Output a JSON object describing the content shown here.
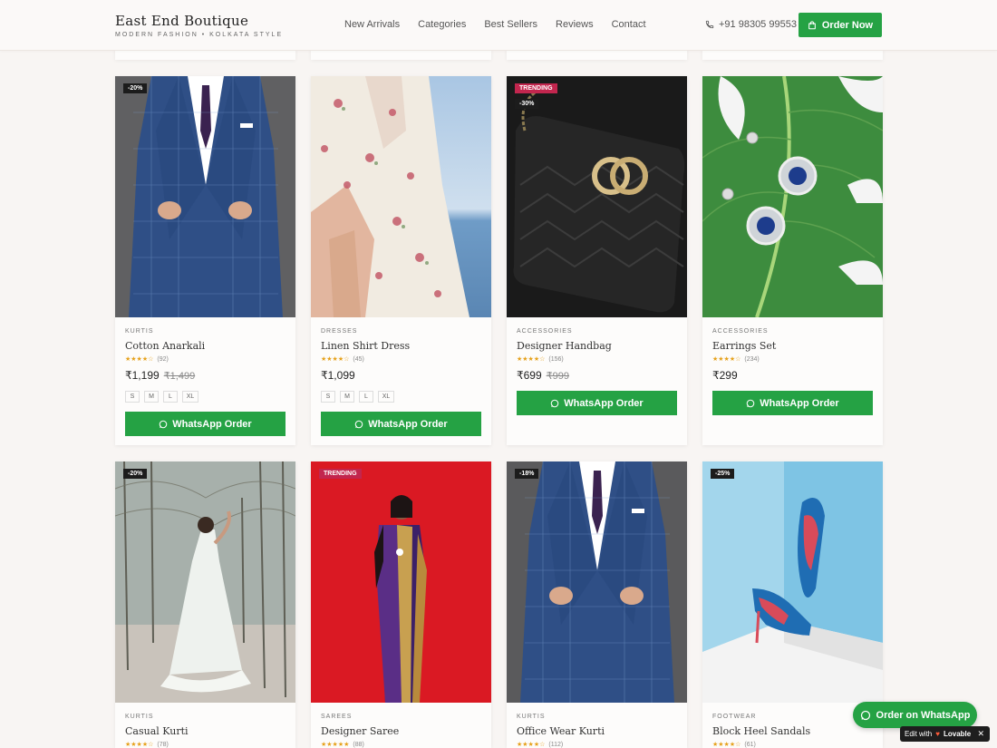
{
  "brand": {
    "title": "East End Boutique",
    "tagline": "MODERN FASHION • KOLKATA STYLE"
  },
  "nav": [
    "New Arrivals",
    "Categories",
    "Best Sellers",
    "Reviews",
    "Contact"
  ],
  "phone": "+91 98305 99553",
  "order_now": "Order Now",
  "colors": {
    "accent": "#25a244",
    "trending": "#c2264e",
    "discount": "#1c1c1c",
    "star": "#e6a11b"
  },
  "wa_label": "WhatsApp Order",
  "row1": [
    {
      "category": "KURTIS",
      "name": "Cotton Anarkali",
      "badge": "-20%",
      "trend": "",
      "stars": "★★★★☆",
      "reviews": "(92)",
      "price": "₹1,199",
      "orig": "₹1,499",
      "sizes": [
        "S",
        "M",
        "L",
        "XL"
      ],
      "image": "blue-checked-suit"
    },
    {
      "category": "DRESSES",
      "name": "Linen Shirt Dress",
      "badge": "",
      "trend": "",
      "stars": "★★★★☆",
      "reviews": "(45)",
      "price": "₹1,099",
      "orig": "",
      "sizes": [
        "S",
        "M",
        "L",
        "XL"
      ],
      "image": "floral-dress-by-sea"
    },
    {
      "category": "ACCESSORIES",
      "name": "Designer Handbag",
      "badge": "-30%",
      "trend": "TRENDING",
      "stars": "★★★★☆",
      "reviews": "(156)",
      "price": "₹699",
      "orig": "₹999",
      "sizes": [],
      "image": "black-quilted-handbag"
    },
    {
      "category": "ACCESSORIES",
      "name": "Earrings Set",
      "badge": "",
      "trend": "",
      "stars": "★★★★☆",
      "reviews": "(234)",
      "price": "₹299",
      "orig": "",
      "sizes": [],
      "image": "earrings-on-leaf"
    }
  ],
  "row2": [
    {
      "category": "KURTIS",
      "name": "Casual Kurti",
      "badge": "-20%",
      "trend": "",
      "stars": "★★★★☆",
      "reviews": "(78)",
      "image": "white-lehenga-outdoor"
    },
    {
      "category": "SAREES",
      "name": "Designer Saree",
      "badge": "",
      "trend": "TRENDING",
      "stars": "★★★★★",
      "reviews": "(88)",
      "image": "purple-saree-red-background"
    },
    {
      "category": "KURTIS",
      "name": "Office Wear Kurti",
      "badge": "-18%",
      "trend": "",
      "stars": "★★★★☆",
      "reviews": "(112)",
      "image": "blue-checked-suit"
    },
    {
      "category": "FOOTWEAR",
      "name": "Block Heel Sandals",
      "badge": "-25%",
      "trend": "",
      "stars": "★★★★☆",
      "reviews": "(61)",
      "image": "floral-high-heels"
    }
  ],
  "float_wa": "Order on WhatsApp",
  "lovable": {
    "edit": "Edit with",
    "brand": "Lovable",
    "close": "✕"
  }
}
